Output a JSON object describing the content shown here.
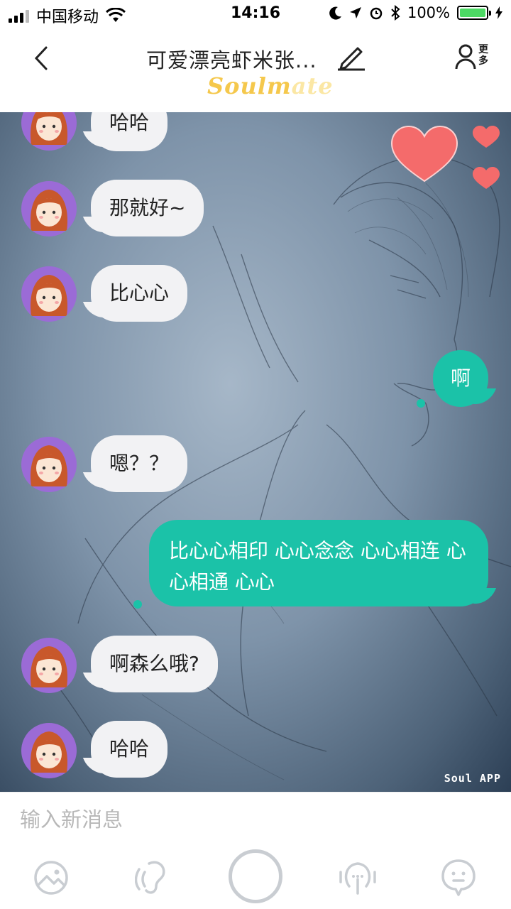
{
  "status_bar": {
    "carrier": "中国移动",
    "time": "14:16",
    "battery": "100%",
    "battery_level": 1.0
  },
  "header": {
    "title": "可爱漂亮虾米张...",
    "more_label": "更多",
    "logo_part1": "Soulm",
    "logo_part2": "ate"
  },
  "messages": [
    {
      "side": "left",
      "text": "哈哈"
    },
    {
      "side": "left",
      "text": "那就好~"
    },
    {
      "side": "left",
      "text": "比心心"
    },
    {
      "side": "right",
      "text": "啊"
    },
    {
      "side": "left",
      "text": "嗯？？"
    },
    {
      "side": "right",
      "text": "比心心相印 心心念念 心心相连 心心相通 心心"
    },
    {
      "side": "left",
      "text": "啊森么哦?"
    },
    {
      "side": "left",
      "text": "哈哈"
    }
  ],
  "watermark": "Soul APP",
  "input": {
    "placeholder": "输入新消息",
    "value": ""
  },
  "toolbar_icons": [
    "image-icon",
    "voice-icon",
    "record-button",
    "voice-call-icon",
    "emoji-icon"
  ],
  "colors": {
    "accent": "#1bc2a8",
    "bubble_left": "#f2f2f4",
    "avatar_bg": "#9b6bd6",
    "heart": "#f46b6b"
  }
}
